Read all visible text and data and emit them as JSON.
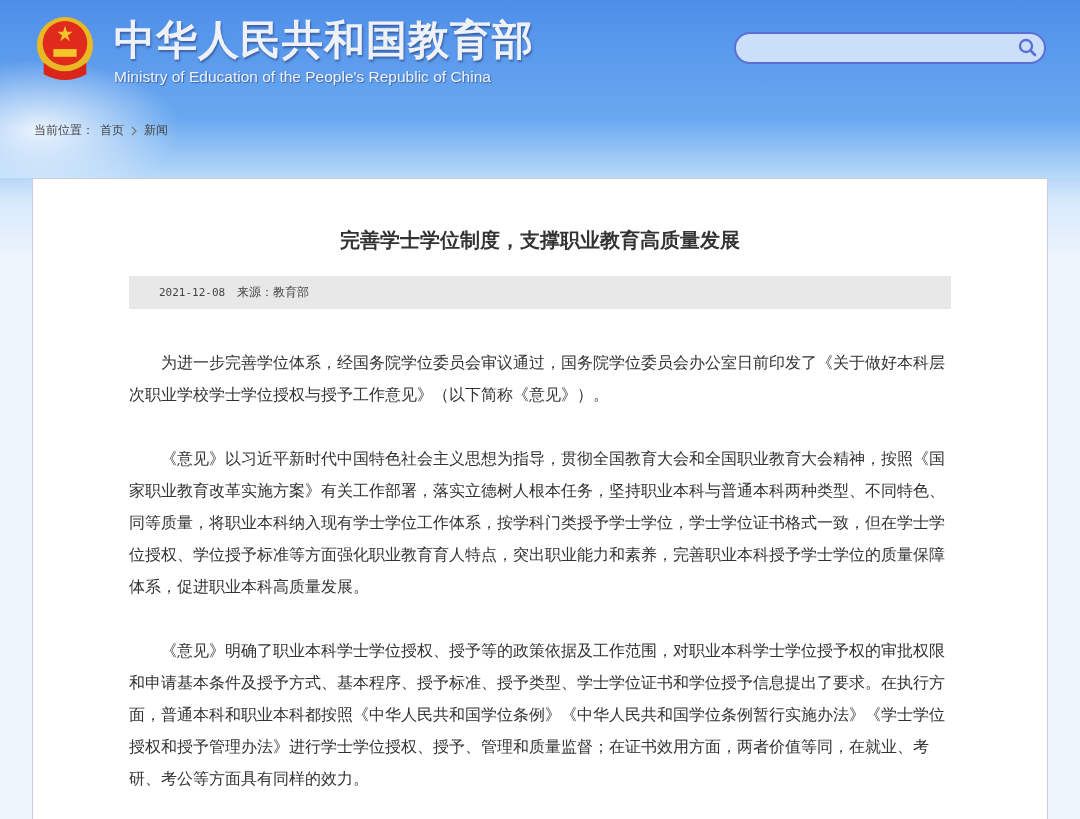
{
  "header": {
    "title": "中华人民共和国教育部",
    "subtitle": "Ministry of Education of the People's Republic of China"
  },
  "breadcrumb": {
    "label": "当前位置：",
    "items": [
      "首页",
      "新闻"
    ]
  },
  "article": {
    "title": "完善学士学位制度，支撑职业教育高质量发展",
    "date": "2021-12-08",
    "source": "来源：教育部",
    "paragraphs": [
      "为进一步完善学位体系，经国务院学位委员会审议通过，国务院学位委员会办公室日前印发了《关于做好本科层次职业学校学士学位授权与授予工作意见》（以下简称《意见》）。",
      "《意见》以习近平新时代中国特色社会主义思想为指导，贯彻全国教育大会和全国职业教育大会精神，按照《国家职业教育改革实施方案》有关工作部署，落实立德树人根本任务，坚持职业本科与普通本科两种类型、不同特色、同等质量，将职业本科纳入现有学士学位工作体系，按学科门类授予学士学位，学士学位证书格式一致，但在学士学位授权、学位授予标准等方面强化职业教育育人特点，突出职业能力和素养，完善职业本科授予学士学位的质量保障体系，促进职业本科高质量发展。",
      "《意见》明确了职业本科学士学位授权、授予等的政策依据及工作范围，对职业本科学士学位授予权的审批权限和申请基本条件及授予方式、基本程序、授予标准、授予类型、学士学位证书和学位授予信息提出了要求。在执行方面，普通本科和职业本科都按照《中华人民共和国学位条例》《中华人民共和国学位条例暂行实施办法》《学士学位授权和授予管理办法》进行学士学位授权、授予、管理和质量监督；在证书效用方面，两者价值等同，在就业、考研、考公等方面具有同样的效力。"
    ]
  }
}
